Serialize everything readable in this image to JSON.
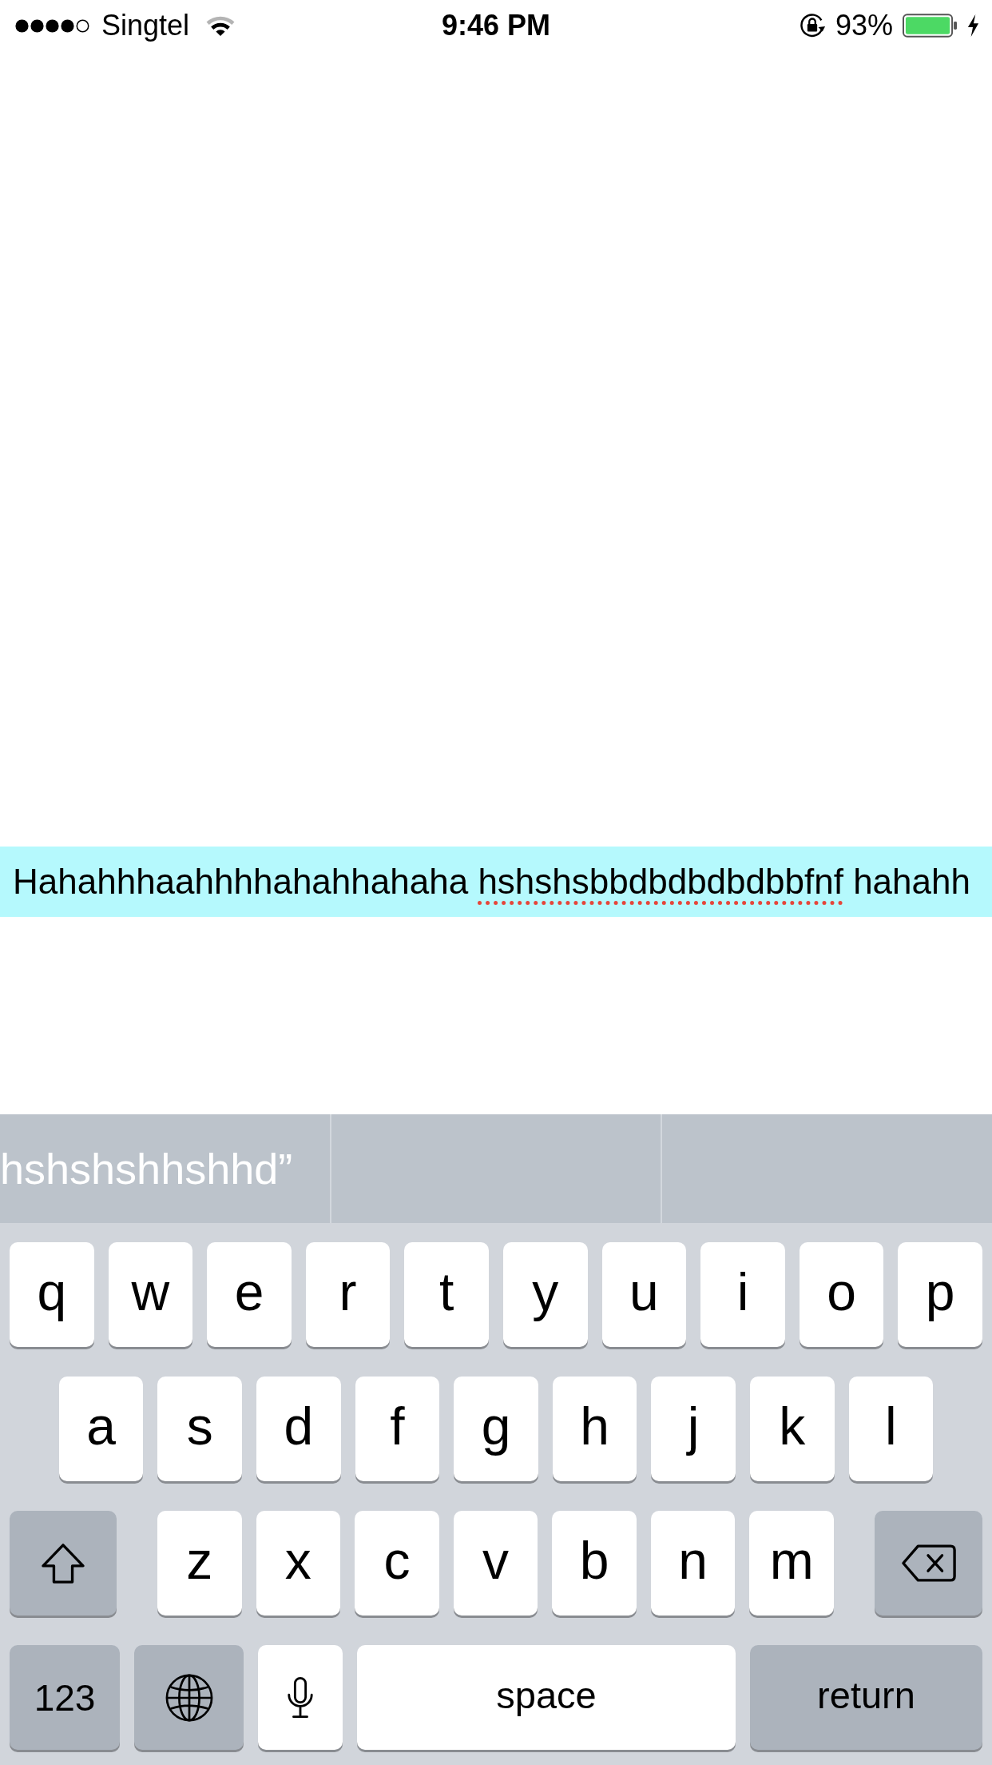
{
  "status_bar": {
    "carrier": "Singtel",
    "time": "9:46 PM",
    "orientation_lock": true,
    "battery_percent": "93%",
    "charging": true
  },
  "text_field": {
    "words": [
      {
        "text": "Hahahhhaahhhhahahhahaha",
        "misspelled": false
      },
      {
        "text": "hshshsbbdbdbdbdbbfnf",
        "misspelled": true
      },
      {
        "text": "hahahh",
        "misspelled": false
      }
    ]
  },
  "suggestion_bar": {
    "suggestions": [
      "hshshshhshhd”"
    ]
  },
  "keyboard": {
    "rows": [
      {
        "keys": [
          {
            "kind": "letter",
            "label": "q"
          },
          {
            "kind": "letter",
            "label": "w"
          },
          {
            "kind": "letter",
            "label": "e"
          },
          {
            "kind": "letter",
            "label": "r"
          },
          {
            "kind": "letter",
            "label": "t"
          },
          {
            "kind": "letter",
            "label": "y"
          },
          {
            "kind": "letter",
            "label": "u"
          },
          {
            "kind": "letter",
            "label": "i"
          },
          {
            "kind": "letter",
            "label": "o"
          },
          {
            "kind": "letter",
            "label": "p"
          }
        ]
      },
      {
        "keys": [
          {
            "kind": "letter",
            "label": "a"
          },
          {
            "kind": "letter",
            "label": "s"
          },
          {
            "kind": "letter",
            "label": "d"
          },
          {
            "kind": "letter",
            "label": "f"
          },
          {
            "kind": "letter",
            "label": "g"
          },
          {
            "kind": "letter",
            "label": "h"
          },
          {
            "kind": "letter",
            "label": "j"
          },
          {
            "kind": "letter",
            "label": "k"
          },
          {
            "kind": "letter",
            "label": "l"
          }
        ]
      },
      {
        "keys": [
          {
            "kind": "shift"
          },
          {
            "kind": "letter",
            "label": "z"
          },
          {
            "kind": "letter",
            "label": "x"
          },
          {
            "kind": "letter",
            "label": "c"
          },
          {
            "kind": "letter",
            "label": "v"
          },
          {
            "kind": "letter",
            "label": "b"
          },
          {
            "kind": "letter",
            "label": "n"
          },
          {
            "kind": "letter",
            "label": "m"
          },
          {
            "kind": "delete"
          }
        ]
      },
      {
        "keys": [
          {
            "kind": "mode",
            "label": "123"
          },
          {
            "kind": "globe"
          },
          {
            "kind": "dictation"
          },
          {
            "kind": "space",
            "label": "space"
          },
          {
            "kind": "return",
            "label": "return"
          }
        ]
      }
    ]
  }
}
